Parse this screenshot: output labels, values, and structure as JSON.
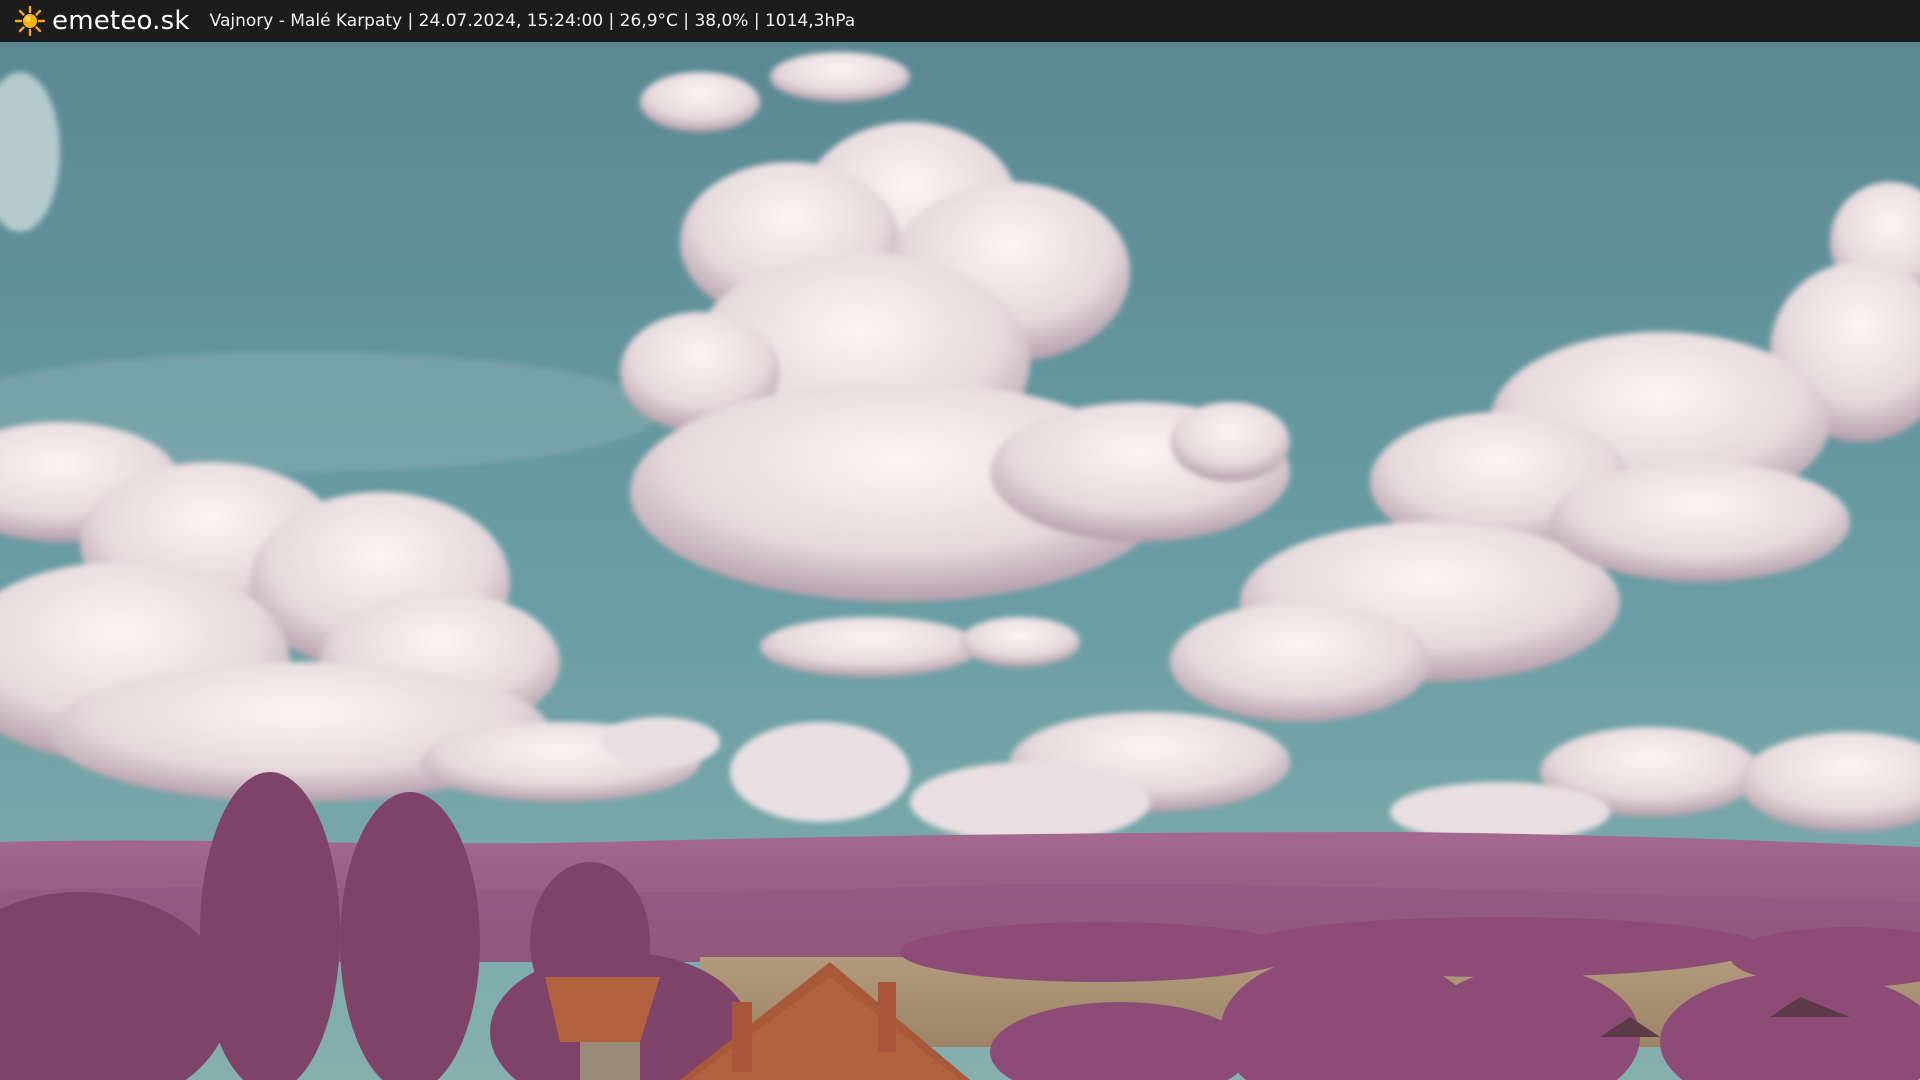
{
  "header": {
    "logo_icon": "sun-icon",
    "brand": "emeteo.sk",
    "caption": "Vajnory - Malé Karpaty | 24.07.2024, 15:24:00 | 26,9°C | 38,0% | 1014,3hPa"
  },
  "scene": {
    "type": "webcam-image",
    "palette": {
      "sky_top": "#5f8e98",
      "sky_bottom": "#6fa2a6",
      "cloud": "#efe6e6",
      "cloud_shadow": "#a48f9f",
      "hills": "#9a5b86",
      "trees": "#8a4a73",
      "field": "#a88e72",
      "roof": "#b5643f"
    }
  }
}
